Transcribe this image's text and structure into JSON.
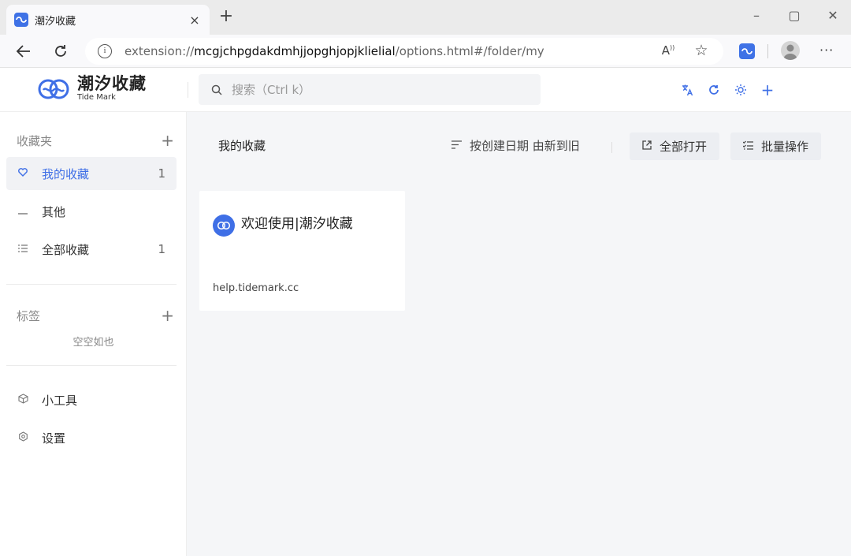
{
  "browser": {
    "tab_title": "潮汐收藏",
    "tab_close": "×",
    "new_tab": "+",
    "window_controls": {
      "minimize": "–",
      "maximize": "▢",
      "close": "✕"
    },
    "url_prefix": "extension://",
    "url_host": "mcgjchpgdakdmhjjopghjopjklielial",
    "url_path": "/options.html#/folder/my",
    "read_aloud_label": "A",
    "favorite_icon_glyph": "☆",
    "more_glyph": "···"
  },
  "app": {
    "logo_cn": "潮汐收藏",
    "logo_en": "Tide Mark",
    "search_placeholder": "搜索（Ctrl k）",
    "header_icons": [
      "translate-icon",
      "sync-icon",
      "theme-icon",
      "add-icon"
    ],
    "header_add": "+",
    "accent_color": "#3f6fe6"
  },
  "sidebar": {
    "folders_title": "收藏夹",
    "folders_add": "+",
    "folders": [
      {
        "label": "我的收藏",
        "count": "1",
        "icon": "heart-icon",
        "active": true
      },
      {
        "label": "其他",
        "count": "",
        "icon": "dash-icon",
        "active": false
      },
      {
        "label": "全部收藏",
        "count": "1",
        "icon": "list-icon",
        "active": false
      }
    ],
    "tags_title": "标签",
    "tags_add": "+",
    "tags_empty": "空空如也",
    "tools": [
      {
        "label": "小工具",
        "icon": "cube-icon"
      },
      {
        "label": "设置",
        "icon": "settings-icon"
      }
    ]
  },
  "main": {
    "title": "我的收藏",
    "sort_label": "按创建日期 由新到旧",
    "open_all_label": "全部打开",
    "batch_label": "批量操作",
    "cards": [
      {
        "title": "欢迎使用|潮汐收藏",
        "url": "help.tidemark.cc"
      }
    ]
  }
}
